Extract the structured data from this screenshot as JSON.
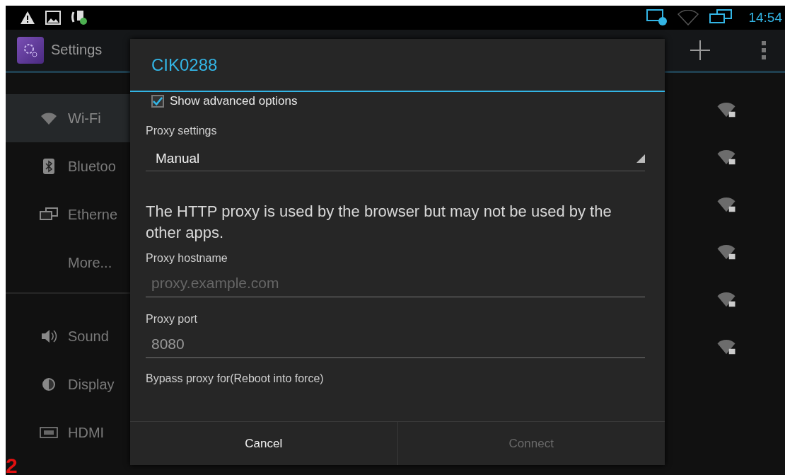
{
  "status_bar": {
    "time": "14:54"
  },
  "action_bar": {
    "title": "Settings"
  },
  "sidebar": {
    "sections": [
      {
        "items": [
          {
            "label": "Wi-Fi",
            "selected": true
          },
          {
            "label": "Bluetoo",
            "selected": false
          },
          {
            "label": "Etherne",
            "selected": false
          },
          {
            "label": "More...",
            "selected": false
          }
        ]
      },
      {
        "items": [
          {
            "label": "Sound",
            "selected": false
          },
          {
            "label": "Display",
            "selected": false
          },
          {
            "label": "HDMI",
            "selected": false
          }
        ]
      }
    ]
  },
  "dialog": {
    "title": "CIK0288",
    "show_advanced": {
      "label": "Show advanced options",
      "checked": true
    },
    "proxy_settings": {
      "label": "Proxy settings",
      "value": "Manual"
    },
    "description": "The HTTP proxy is used by the browser but may not be used by the other apps.",
    "hostname": {
      "label": "Proxy hostname",
      "placeholder": "proxy.example.com"
    },
    "port": {
      "label": "Proxy port",
      "value": "8080"
    },
    "bypass_label": "Bypass proxy for(Reboot into force)",
    "buttons": [
      {
        "label": "Cancel",
        "disabled": false
      },
      {
        "label": "Connect",
        "disabled": true
      }
    ]
  },
  "annotation_marker": "2"
}
